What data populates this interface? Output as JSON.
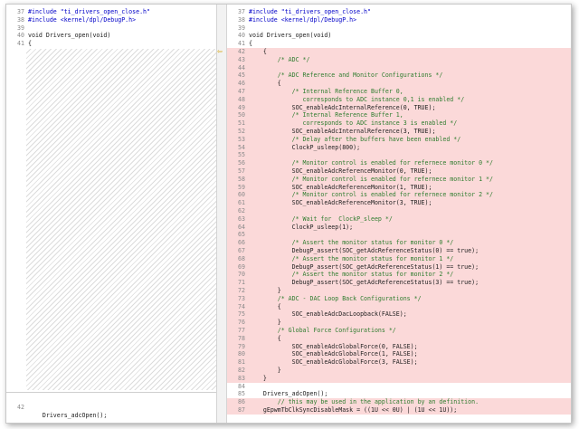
{
  "left": {
    "lines": [
      {
        "n": "37",
        "t": "#include \"ti_drivers_open_close.h\""
      },
      {
        "n": "38",
        "t": "#include <kernel/dpl/DebugP.h>"
      },
      {
        "n": "39",
        "t": ""
      },
      {
        "n": "40",
        "t": "void Drivers_open(void)"
      },
      {
        "n": "41",
        "t": "{"
      }
    ],
    "bottom": {
      "n": "42",
      "t": "    Drivers_adcOpen();"
    }
  },
  "right": {
    "lines": [
      {
        "n": "37",
        "t": "#include \"ti_drivers_open_close.h\"",
        "d": false
      },
      {
        "n": "38",
        "t": "#include <kernel/dpl/DebugP.h>",
        "d": false
      },
      {
        "n": "39",
        "t": "",
        "d": false
      },
      {
        "n": "40",
        "t": "void Drivers_open(void)",
        "d": false
      },
      {
        "n": "41",
        "t": "{",
        "d": false
      },
      {
        "n": "42",
        "t": "    {",
        "d": true
      },
      {
        "n": "43",
        "t": "        /* ADC */",
        "d": true
      },
      {
        "n": "44",
        "t": "",
        "d": true
      },
      {
        "n": "45",
        "t": "        /* ADC Reference and Monitor Configurations */",
        "d": true
      },
      {
        "n": "46",
        "t": "        {",
        "d": true
      },
      {
        "n": "47",
        "t": "            /* Internal Reference Buffer 0,",
        "d": true
      },
      {
        "n": "48",
        "t": "               corresponds to ADC instance 0,1 is enabled */",
        "d": true
      },
      {
        "n": "49",
        "t": "            SOC_enableAdcInternalReference(0, TRUE);",
        "d": true
      },
      {
        "n": "50",
        "t": "            /* Internal Reference Buffer 1,",
        "d": true
      },
      {
        "n": "51",
        "t": "               corresponds to ADC instance 3 is enabled */",
        "d": true
      },
      {
        "n": "52",
        "t": "            SOC_enableAdcInternalReference(3, TRUE);",
        "d": true
      },
      {
        "n": "53",
        "t": "            /* Delay after the buffers have been enabled */",
        "d": true
      },
      {
        "n": "54",
        "t": "            ClockP_usleep(800);",
        "d": true
      },
      {
        "n": "55",
        "t": "",
        "d": true
      },
      {
        "n": "56",
        "t": "            /* Monitor control is enabled for refernece monitor 0 */",
        "d": true
      },
      {
        "n": "57",
        "t": "            SOC_enableAdcReferenceMonitor(0, TRUE);",
        "d": true
      },
      {
        "n": "58",
        "t": "            /* Monitor control is enabled for refernece monitor 1 */",
        "d": true
      },
      {
        "n": "59",
        "t": "            SOC_enableAdcReferenceMonitor(1, TRUE);",
        "d": true
      },
      {
        "n": "60",
        "t": "            /* Monitor control is enabled for refernece monitor 2 */",
        "d": true
      },
      {
        "n": "61",
        "t": "            SOC_enableAdcReferenceMonitor(3, TRUE);",
        "d": true
      },
      {
        "n": "62",
        "t": "",
        "d": true
      },
      {
        "n": "63",
        "t": "            /* Wait for  ClockP_sleep */",
        "d": true
      },
      {
        "n": "64",
        "t": "            ClockP_usleep(1);",
        "d": true
      },
      {
        "n": "65",
        "t": "",
        "d": true
      },
      {
        "n": "66",
        "t": "            /* Assert the monitor status for monitor 0 */",
        "d": true
      },
      {
        "n": "67",
        "t": "            DebugP_assert(SOC_getAdcReferenceStatus(0) == true);",
        "d": true
      },
      {
        "n": "68",
        "t": "            /* Assert the monitor status for monitor 1 */",
        "d": true
      },
      {
        "n": "69",
        "t": "            DebugP_assert(SOC_getAdcReferenceStatus(1) == true);",
        "d": true
      },
      {
        "n": "70",
        "t": "            /* Assert the monitor status for monitor 2 */",
        "d": true
      },
      {
        "n": "71",
        "t": "            DebugP_assert(SOC_getAdcReferenceStatus(3) == true);",
        "d": true
      },
      {
        "n": "72",
        "t": "        }",
        "d": true
      },
      {
        "n": "73",
        "t": "        /* ADC - DAC Loop Back Configurations */",
        "d": true
      },
      {
        "n": "74",
        "t": "        {",
        "d": true
      },
      {
        "n": "75",
        "t": "            SOC_enableAdcDacLoopback(FALSE);",
        "d": true
      },
      {
        "n": "76",
        "t": "        }",
        "d": true
      },
      {
        "n": "77",
        "t": "        /* Global Force Configurations */",
        "d": true
      },
      {
        "n": "78",
        "t": "        {",
        "d": true
      },
      {
        "n": "79",
        "t": "            SOC_enableAdcGlobalForce(0, FALSE);",
        "d": true
      },
      {
        "n": "80",
        "t": "            SOC_enableAdcGlobalForce(1, FALSE);",
        "d": true
      },
      {
        "n": "81",
        "t": "            SOC_enableAdcGlobalForce(3, FALSE);",
        "d": true
      },
      {
        "n": "82",
        "t": "        }",
        "d": true
      },
      {
        "n": "83",
        "t": "    }",
        "d": true
      },
      {
        "n": "84",
        "t": "",
        "d": false
      },
      {
        "n": "85",
        "t": "    Drivers_adcOpen();",
        "d": false
      },
      {
        "n": "86",
        "t": "        // this may be used in the application by an definition.",
        "d": true
      },
      {
        "n": "87",
        "t": "    gEpwmTbClkSyncDisableMask = ((1U << 0U) | (1U << 1U));",
        "d": true
      }
    ]
  },
  "colors": {
    "deleted_bg": "#fbd9d9",
    "keyword": "#0000c8",
    "string": "#a31515",
    "comment": "#2f7d2f",
    "marker": "#d4a000"
  },
  "icons": {
    "change_marker": "arrow-right-icon"
  }
}
